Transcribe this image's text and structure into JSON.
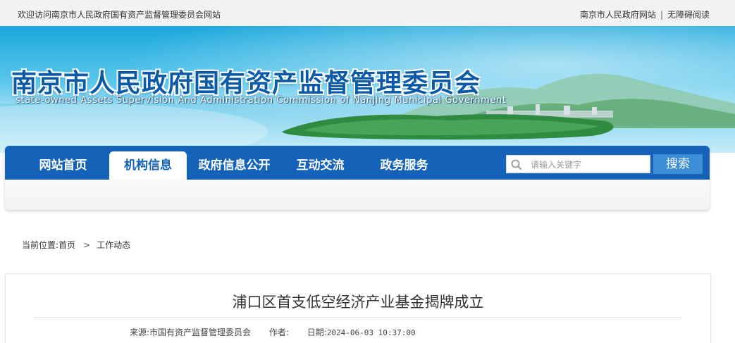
{
  "topbar": {
    "welcome": "欢迎访问南京市人民政府国有资产监督管理委员会网站",
    "link_gov": "南京市人民政府网站",
    "separator": "|",
    "link_accessible": "无障碍阅读"
  },
  "banner": {
    "title_cn": "南京市人民政府国有资产监督管理委员会",
    "title_en": "state-owned Assets Supervision And Administration Commission of Nanjing Municipal Government"
  },
  "nav": {
    "items": [
      {
        "label": "网站首页",
        "active": false
      },
      {
        "label": "机构信息",
        "active": true
      },
      {
        "label": "政府信息公开",
        "active": false
      },
      {
        "label": "互动交流",
        "active": false
      },
      {
        "label": "政务服务",
        "active": false
      }
    ],
    "search_placeholder": "请输入关键字",
    "search_button": "搜索"
  },
  "breadcrumb": {
    "prefix": "当前位置:",
    "home": "首页",
    "chevron": ">",
    "current": "工作动态"
  },
  "article": {
    "title": "浦口区首支低空经济产业基金揭牌成立",
    "source_label": "来源:",
    "source": "市国有资产监督管理委员会",
    "author_label": "作者:",
    "author": "",
    "date_label": "日期:",
    "date": "2024-06-03 10:37:00"
  },
  "colors": {
    "nav_blue": "#1463b9",
    "title_blue": "#0b5aa8",
    "search_button": "#3c8ed6"
  }
}
